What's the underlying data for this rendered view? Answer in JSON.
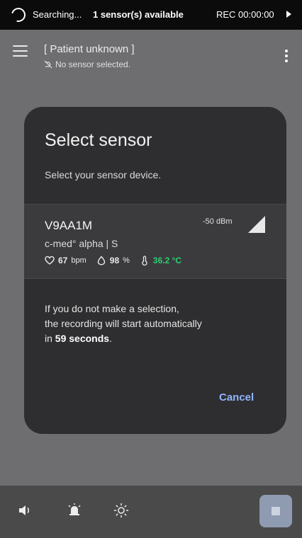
{
  "status_bar": {
    "searching": "Searching...",
    "sensors": "1 sensor(s) available",
    "rec": "REC 00:00:00",
    "icons": [
      "spinner-icon",
      "play-icon"
    ]
  },
  "app_bar": {
    "patient": "[ Patient unknown ]",
    "sensor_status": "No sensor selected.",
    "icons": [
      "menu-icon",
      "no-sensor-icon",
      "more-icon"
    ]
  },
  "dialog": {
    "title": "Select sensor",
    "subtitle": "Select your sensor device.",
    "sensor": {
      "id": "V9AA1M",
      "model": "c-med° alpha | S",
      "signal": "-50 dBm",
      "heart_rate": "67",
      "heart_rate_unit": "bpm",
      "spo2": "98",
      "spo2_unit": "%",
      "temperature": "36.2 °C"
    },
    "info": {
      "line1": "If you do not make a selection,",
      "line2": "the recording will start automatically",
      "line3_prefix": "in",
      "seconds": "59 seconds",
      "line3_suffix": "."
    },
    "cancel": "Cancel"
  },
  "bottom_bar": {
    "icons": [
      "volume-icon",
      "alarm-icon",
      "brightness-icon",
      "stop-icon"
    ]
  },
  "colors": {
    "background": "#6e6e70",
    "dialog": "#2e2e30",
    "sensor_card": "#3b3b3e",
    "accent": "#8fb4ff",
    "temperature": "#2ecc71",
    "stop_button": "#8e9bb0"
  }
}
